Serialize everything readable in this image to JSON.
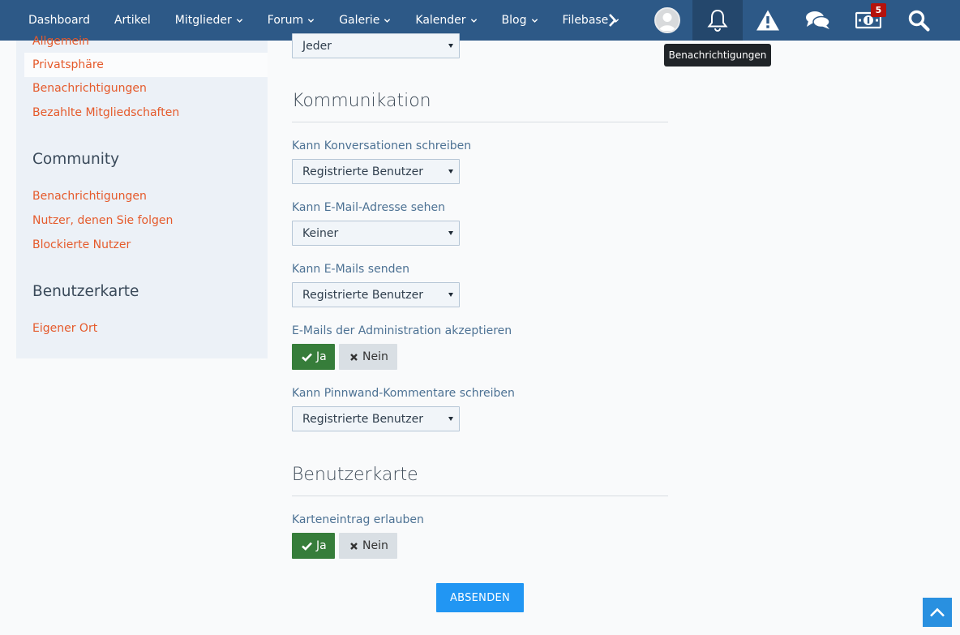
{
  "nav": {
    "items": [
      {
        "label": "Dashboard",
        "dropdown": false
      },
      {
        "label": "Artikel",
        "dropdown": false
      },
      {
        "label": "Mitglieder",
        "dropdown": true
      },
      {
        "label": "Forum",
        "dropdown": true
      },
      {
        "label": "Galerie",
        "dropdown": true
      },
      {
        "label": "Kalender",
        "dropdown": true
      },
      {
        "label": "Blog",
        "dropdown": true
      },
      {
        "label": "Filebase",
        "dropdown": true
      }
    ],
    "more_icon": "chevron-right-icon",
    "user_panel": {
      "avatar_icon": "user-avatar-icon",
      "notifications_icon": "bell-icon",
      "moderation_icon": "warning-triangle-icon",
      "conversations_icon": "chat-bubbles-icon",
      "paid_icon": "money-icon",
      "paid_badge": "5",
      "search_icon": "search-icon"
    },
    "tooltip": "Benachrichtigungen"
  },
  "sidebar": {
    "account_links": [
      "Allgemein",
      "Privatsphäre",
      "Benachrichtigungen",
      "Bezahlte Mitgliedschaften"
    ],
    "community_title": "Community",
    "community_links": [
      "Benachrichtigungen",
      "Nutzer, denen Sie folgen",
      "Blockierte Nutzer"
    ],
    "map_title": "Benutzerkarte",
    "map_links": [
      "Eigener Ort"
    ]
  },
  "form": {
    "top_select_value": "Jeder",
    "communication": {
      "title": "Kommunikation",
      "conversations": {
        "label": "Kann Konversationen schreiben",
        "value": "Registrierte Benutzer"
      },
      "email_visible": {
        "label": "Kann E-Mail-Adresse sehen",
        "value": "Keiner"
      },
      "send_mails": {
        "label": "Kann E-Mails senden",
        "value": "Registrierte Benutzer"
      },
      "admin_mails": {
        "label": "E-Mails der Administration akzeptieren",
        "yes": "Ja",
        "no": "Nein",
        "selected": "Ja"
      },
      "wall_comments": {
        "label": "Kann Pinnwand-Kommentare schreiben",
        "value": "Registrierte Benutzer"
      }
    },
    "usermap": {
      "title": "Benutzerkarte",
      "allow_entry": {
        "label": "Karteneintrag erlauben",
        "yes": "Ja",
        "no": "Nein",
        "selected": "Ja"
      }
    },
    "submit_label": "ABSENDEN"
  },
  "colors": {
    "nav_bg": "#2d5987",
    "link": "#e55a2b",
    "yes_active": "#367d3a",
    "submit": "#2196f3"
  }
}
